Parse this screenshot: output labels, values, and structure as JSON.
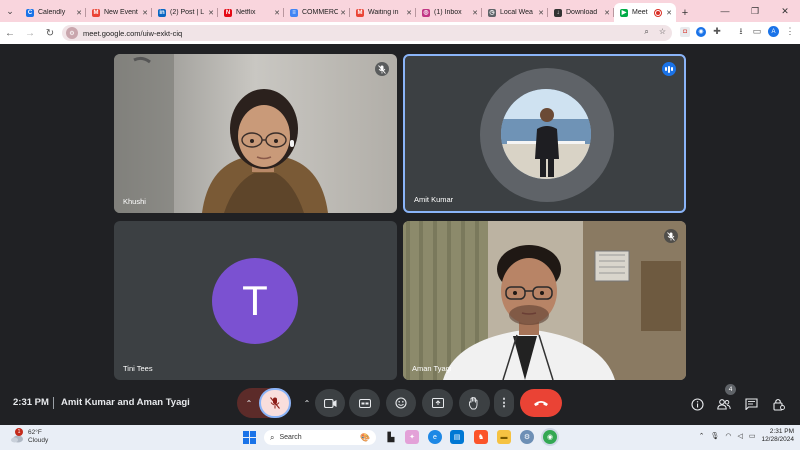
{
  "browser": {
    "tabs": [
      {
        "label": "Calendly",
        "color": "#1a73e8",
        "glyph": "C"
      },
      {
        "label": "New Event",
        "color": "#ea4335",
        "glyph": "M"
      },
      {
        "label": "(2) Post | L",
        "color": "#0a66c2",
        "glyph": "in"
      },
      {
        "label": "Netflix",
        "color": "#e50914",
        "glyph": "N"
      },
      {
        "label": "COMMERC",
        "color": "#4285f4",
        "glyph": "≡"
      },
      {
        "label": "Waiting in",
        "color": "#ea4335",
        "glyph": "M"
      },
      {
        "label": "(1) Inbox",
        "color": "#c13584",
        "glyph": "◎"
      },
      {
        "label": "Local Wea",
        "color": "#5f6368",
        "glyph": "◷"
      },
      {
        "label": "Download",
        "color": "#333333",
        "glyph": "↓"
      }
    ],
    "active_tab": {
      "label": "Meet",
      "color": "#00ac47",
      "glyph": "▶"
    },
    "new_tab": "+",
    "url": "meet.google.com/uiw-exkt-ciq",
    "profile_initial": "A"
  },
  "meet": {
    "participants": [
      {
        "name": "Khushi",
        "muted": true
      },
      {
        "name": "Amit Kumar",
        "speaking": true
      },
      {
        "name": "Tini Tees",
        "initial": "T"
      },
      {
        "name": "Aman Tyagi",
        "muted": true
      }
    ],
    "time": "2:31 PM",
    "title": "Amit Kumar and Aman Tyagi",
    "people_count": "4"
  },
  "taskbar": {
    "weather_temp": "62°F",
    "weather_desc": "Cloudy",
    "weather_badge": "1",
    "search_placeholder": "Search",
    "clock_time": "2:31 PM",
    "clock_date": "12/28/2024"
  },
  "colors": {
    "accent": "#8ab4f8",
    "end_call": "#ea4335",
    "avatar_purple": "#7b51d1",
    "tab_strip": "#f9d5dd"
  }
}
